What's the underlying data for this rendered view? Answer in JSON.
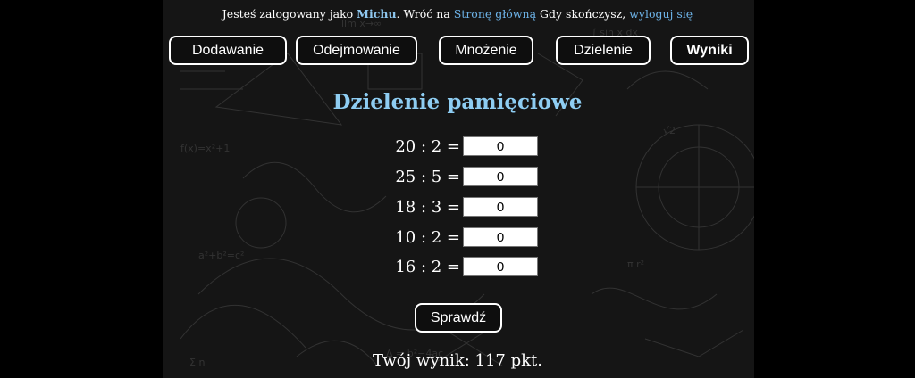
{
  "header": {
    "prefix": "Jesteś zalogowany jako ",
    "username": "Michu",
    "middle": ". Wróć na ",
    "home_link": "Stronę główną",
    "suffix": " Gdy skończysz, ",
    "logout_link": "wyloguj się"
  },
  "nav": {
    "items": [
      {
        "label": "Dodawanie"
      },
      {
        "label": "Odejmowanie"
      },
      {
        "label": "Mnożenie"
      },
      {
        "label": "Dzielenie"
      },
      {
        "label": "Wyniki"
      }
    ]
  },
  "main": {
    "title": "Dzielenie pamięciowe",
    "problems": [
      {
        "expression": "20 : 2 =",
        "answer": "0"
      },
      {
        "expression": "25 : 5 =",
        "answer": "0"
      },
      {
        "expression": "18 : 3 =",
        "answer": "0"
      },
      {
        "expression": "10 : 2 =",
        "answer": "0"
      },
      {
        "expression": "16 : 2 =",
        "answer": "0"
      }
    ],
    "check_label": "Sprawdź",
    "result": "Twój wynik: 117 pkt."
  },
  "colors": {
    "background": "#000000",
    "chalkboard": "#151515",
    "title": "#8ecdf2",
    "link": "#6db3e8"
  }
}
